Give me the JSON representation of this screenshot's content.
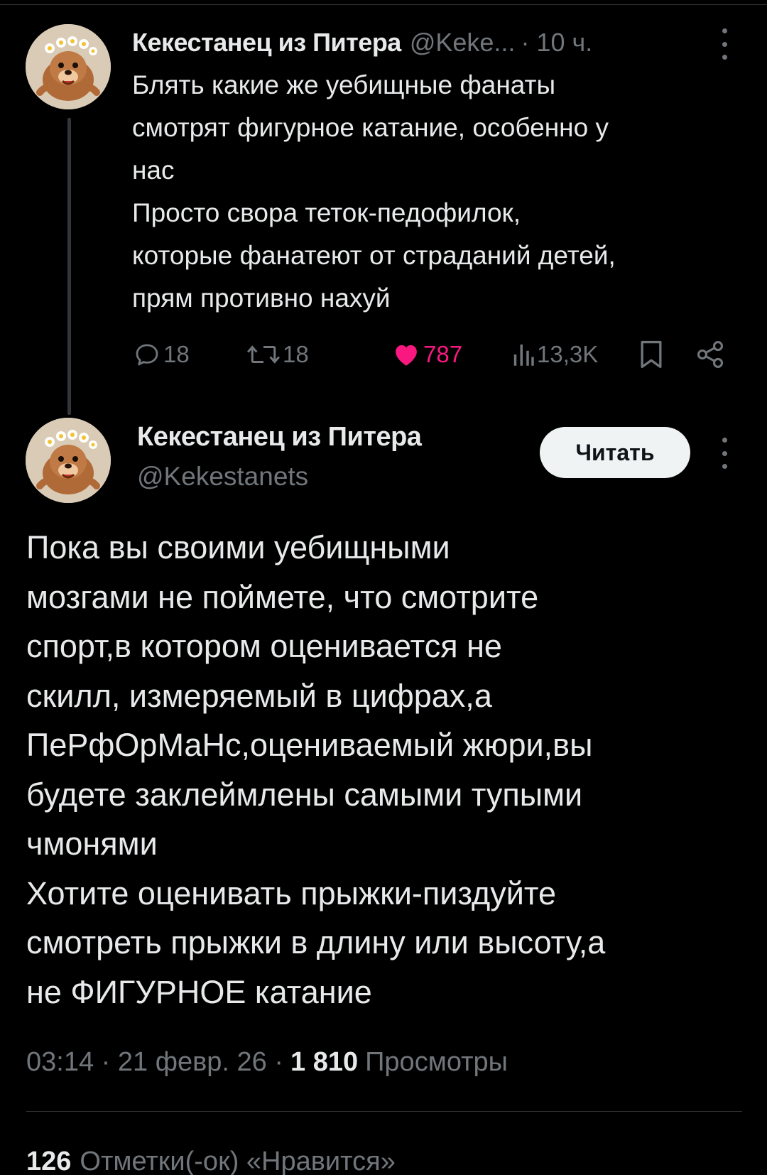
{
  "parent_tweet": {
    "author_name": "Кекестанец из Питера",
    "author_handle": "@Keke...",
    "time": "· 10 ч.",
    "text": "Блять какие же уебищные фанаты\nсмотрят фигурное катание, особенно у\nнас\nПросто свора теток-педофилок,\nкоторые фанатеют от страданий детей,\nпрям противно нахуй",
    "replies": "18",
    "retweets": "18",
    "likes": "787",
    "views": "13,3K",
    "icons": [
      "reply-icon",
      "retweet-icon",
      "like-icon-filled",
      "views-icon",
      "bookmark-icon",
      "share-icon",
      "more-icon"
    ]
  },
  "main_tweet": {
    "author_name": "Кекестанец из Питера",
    "author_handle": "@Kekestanets",
    "follow_label": "Читать",
    "text": "Пока вы своими уебищными\nмозгами не поймете, что смотрите\nспорт,в котором оценивается не\nскилл, измеряемый в цифрах,а\nПеРфОрМаНс,оцениваемый жюри,вы\nбудете заклеймлены самыми тупыми\nчмонями\nХотите оценивать прыжки-пиздуйте\nсмотреть прыжки в длину или высоту,а\nне ФИГУРНОЕ катание",
    "time": "03:14 · 21 февр. 26 ·",
    "views_count": "1 810",
    "views_label": "Просмотры",
    "likes_count": "126",
    "likes_label": "Отметки(-ок) «Нравится»"
  },
  "colors": {
    "background": "#000000",
    "text": "#e7e9ea",
    "secondary": "#71767b",
    "like": "#f91880",
    "divider": "#2f3336"
  }
}
